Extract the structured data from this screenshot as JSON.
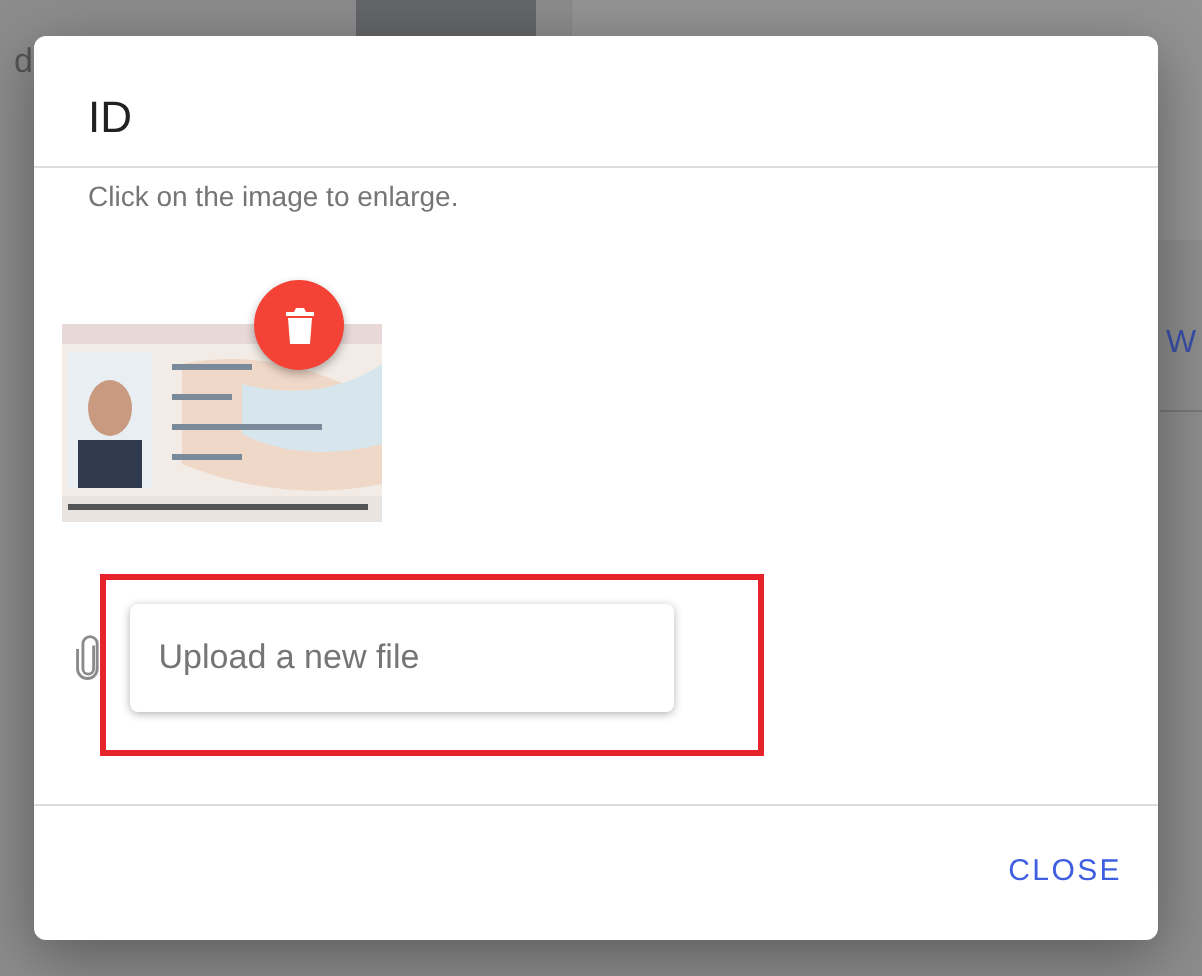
{
  "background": {
    "texts": [
      {
        "text": "d",
        "kind": "plain"
      },
      {
        "text": "W",
        "kind": "link"
      }
    ]
  },
  "dialog": {
    "title": "ID",
    "hint": "Click on the image to enlarge.",
    "image": {
      "kind": "picture",
      "deletable": true
    },
    "upload": {
      "placeholder": "Upload a new file",
      "highlighted": true
    },
    "buttons": [
      "CLOSE"
    ]
  }
}
